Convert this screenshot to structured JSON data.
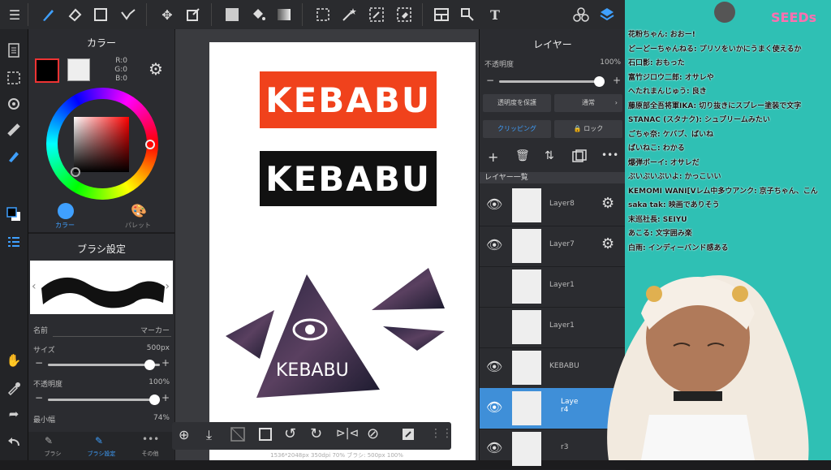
{
  "color_panel": {
    "title": "カラー",
    "rgb": {
      "r": "R:0",
      "g": "G:0",
      "b": "B:0"
    },
    "tabs": [
      {
        "label": "カラー"
      },
      {
        "label": "パレット"
      }
    ]
  },
  "brush_panel": {
    "title": "ブラシ設定",
    "name_label": "名前",
    "name_value": "マーカー",
    "size_label": "サイズ",
    "size_value": "500px",
    "size_fraction": 0.95,
    "opacity_label": "不透明度",
    "opacity_value": "100%",
    "opacity_fraction": 1.0,
    "min_width_label": "最小幅",
    "min_width_value": "74%",
    "bottom_tabs": [
      {
        "label": "ブラシ"
      },
      {
        "label": "ブラシ設定"
      },
      {
        "label": "その他"
      }
    ]
  },
  "canvas": {
    "logo_text_1": "KEBABU",
    "logo_text_2": "KEBABU",
    "triangle_text": "KEBABU",
    "status": "1536*2048px 350dpi 70% ブラシ: 500px 100%",
    "colors": {
      "red_banner": "#f0421c",
      "black_banner": "#111111"
    }
  },
  "layer_panel": {
    "title": "レイヤー",
    "opacity_label": "不透明度",
    "opacity_value": "100%",
    "opacity_fraction": 1.0,
    "protect_label": "透明度を保護",
    "blend_label": "通常",
    "clip_label": "クリッピング",
    "lock_label": "ロック",
    "list_header": "レイヤー一覧",
    "layers": [
      {
        "name": "Layer8",
        "visible": true,
        "settings": true
      },
      {
        "name": "Layer7",
        "visible": true,
        "settings": true
      },
      {
        "name": "Layer1",
        "visible": false,
        "settings": false
      },
      {
        "name": "Layer1",
        "visible": false,
        "settings": false
      },
      {
        "name": "KEBABU",
        "visible": true,
        "settings": false
      },
      {
        "name": "Laye r4",
        "visible": true,
        "settings": false,
        "selected": true
      },
      {
        "name": "r3",
        "visible": true,
        "settings": false
      }
    ]
  },
  "chat": {
    "logo": "SEEDs",
    "lines": [
      "花粉ちゃん: おおー!",
      "どーどーちゃんねる: プリソをいかにうまく使えるか",
      "石口影: おもった",
      "富竹ジロウ二郎: オサレや",
      "へたれまんじゅう: 良き",
      "藤原部全吾将軍IKA: 切り抜きにスプレー塗装で文字",
      "STANAC (スタナク): シュプリームみたい",
      "ごちゃ奈: ケバブ、ばいね",
      "ぱいねこ: わかる",
      "爆弾ボーイ: オサレだ",
      "ぶいぶいぶいよ: かっこいい",
      "KEMOMI WANI[Vレム中多ウアンク: 京子ちゃん、こん",
      "saka tak: 映画でありそう",
      "末巡社長: SEIYU",
      "あこる: 文字囲み楽",
      "白雨: インディーバンド感ある"
    ]
  }
}
